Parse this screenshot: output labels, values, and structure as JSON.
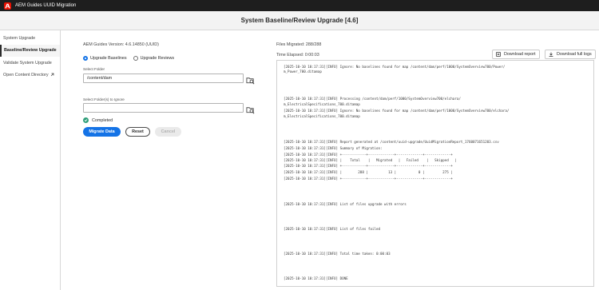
{
  "window": {
    "title": "AEM Guides UUID Migration"
  },
  "header": {
    "title": "System Baseline/Review Upgrade [4.6]"
  },
  "sidebar": {
    "items": [
      {
        "label": "System Upgrade"
      },
      {
        "label": "Baseline/Review Upgrade"
      },
      {
        "label": "Validate System Upgrade"
      },
      {
        "label": "Open Content Directory"
      }
    ]
  },
  "form": {
    "version": "AEM Guides Version: 4.6.14850 (UUID)",
    "radio_baselines": "Upgrade Baselines",
    "radio_reviews": "Upgrade Reviews",
    "folder_label": "Select Folder",
    "folder_value": "/content/dam",
    "ignore_label": "Select Folder(s) to Ignore",
    "ignore_value": "",
    "status": "Completed",
    "migrate_label": "Migrate Data",
    "reset_label": "Reset",
    "cancel_label": "Cancel"
  },
  "stats": {
    "files_migrated": "Files Migrated: 288/288",
    "time_elapsed": "Time Elapsed: 0:00:03"
  },
  "toolbar": {
    "download_report": "Download report",
    "download_logs": "Download full logs"
  },
  "log": {
    "lines": [
      "[2025-10-10 10:17:31][INFO] Ignore: No baselines found for map /content/dam/perf/1000/SystemOverview700/Power/",
      "m_Power_700.ditamap",
      "[2025-10-10 10:17:31][INFO] Processing /content/dam/perf/1000/SystemOverview700/elchara/",
      "m_ElectricalSpecifications_700.ditamap",
      "[2025-10-10 10:17:31][INFO] Ignore: No baselines found for map /content/dam/perf/1000/SystemOverview700/elchara/",
      "m_ElectricalSpecifications_700.ditamap",
      "[2025-10-10 10:17:31][INFO] Report generated at /content/uuid-upgrade/UuidMigrationReport_1760071651203.csv",
      "[2025-10-10 10:17:31][INFO] Summary of Migration:",
      "[2025-10-10 10:17:31][INFO] +------------+-------------+-------------+-------------+",
      "[2025-10-10 10:17:31][INFO] |    Total    |   Migrated   |   Failed    |   Skipped   |",
      "[2025-10-10 10:17:31][INFO] +------------+-------------+-------------+-------------+",
      "[2025-10-10 10:17:31][INFO] |        288 |          13 |           0 |         275 |",
      "[2025-10-10 10:17:31][INFO] +------------+-------------+-------------+-------------+",
      "[2025-10-10 10:17:31][INFO] List of files upgrade with errors",
      "[2025-10-10 10:17:31][INFO] List of files failed",
      "[2025-10-10 10:17:31][INFO] Total time taken: 0:00:03",
      "[2025-10-10 10:17:31][INFO] DONE"
    ]
  },
  "colors": {
    "accent": "#1473e6",
    "success": "#2d9d78",
    "brand": "#eb1000"
  }
}
